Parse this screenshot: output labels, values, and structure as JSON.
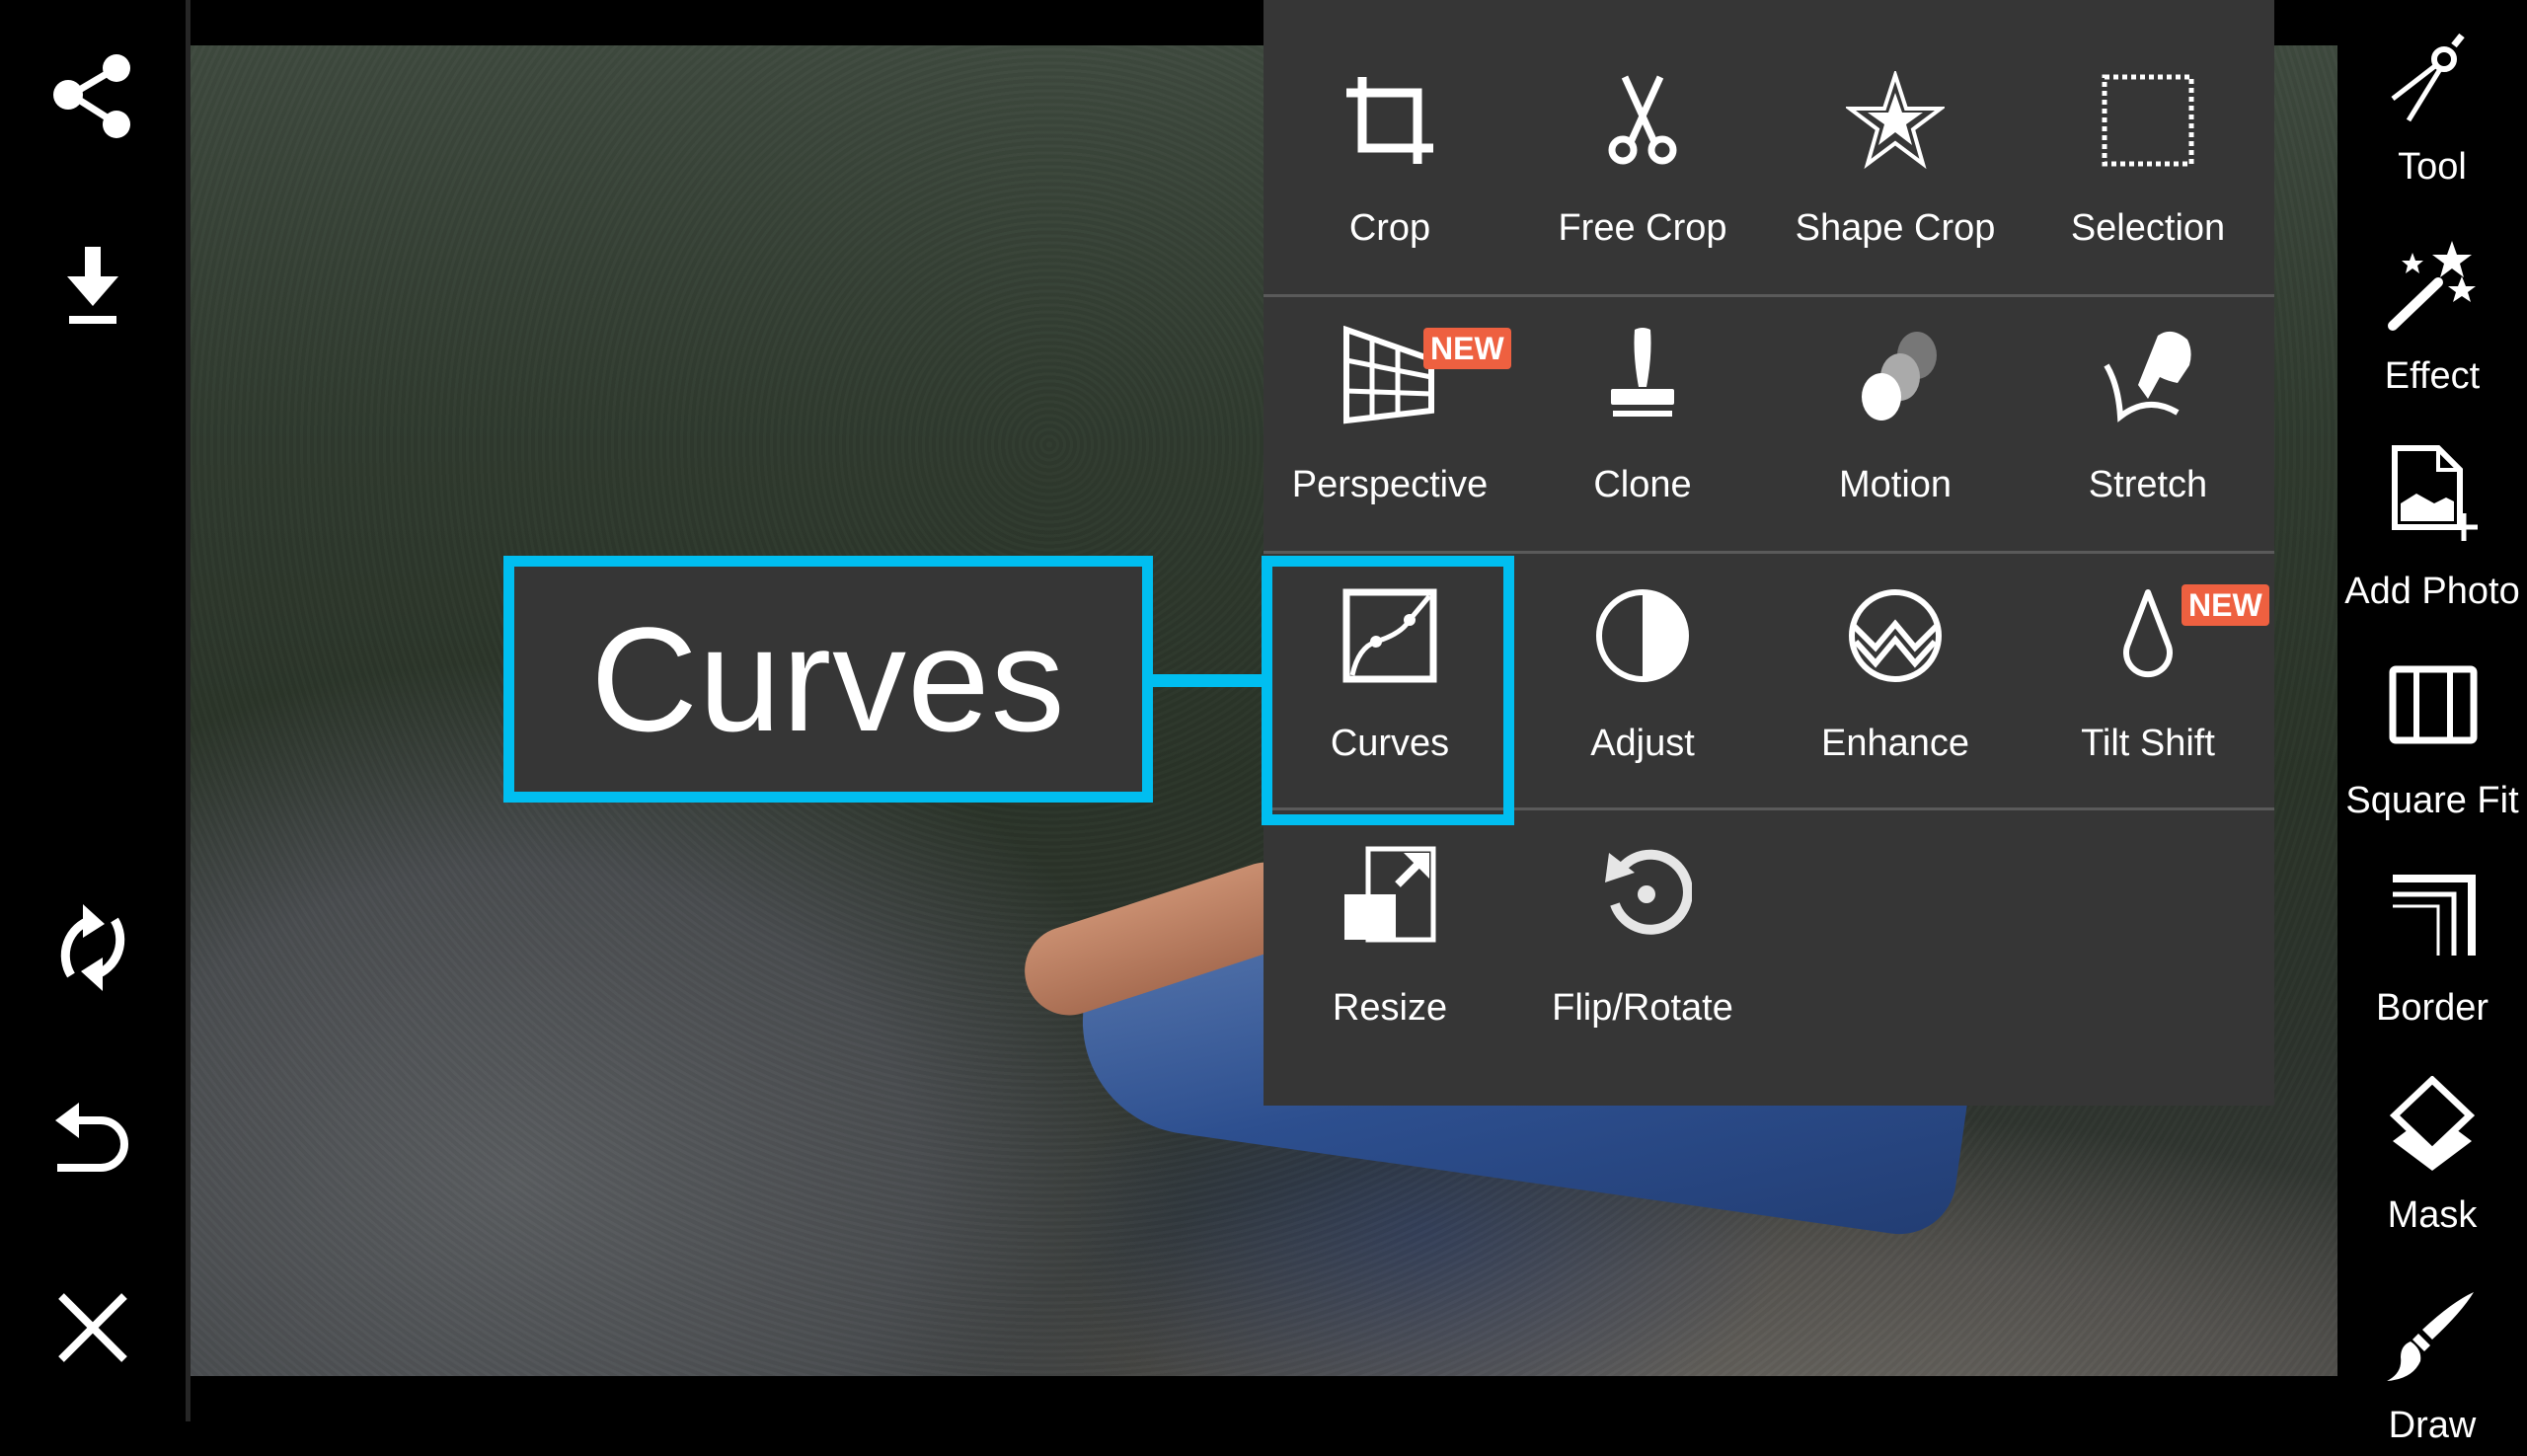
{
  "left_toolbar": {
    "buttons": [
      {
        "name": "share",
        "icon": "share-icon"
      },
      {
        "name": "download",
        "icon": "download-icon"
      },
      {
        "name": "refresh",
        "icon": "refresh-icon"
      },
      {
        "name": "undo",
        "icon": "undo-icon"
      },
      {
        "name": "close",
        "icon": "close-icon"
      }
    ]
  },
  "callout": {
    "label": "Curves"
  },
  "tool_menu": {
    "rows": [
      [
        {
          "label": "Crop",
          "icon": "crop-icon"
        },
        {
          "label": "Free Crop",
          "icon": "scissors-icon"
        },
        {
          "label": "Shape Crop",
          "icon": "star-icon"
        },
        {
          "label": "Selection",
          "icon": "dotted-selection-icon"
        }
      ],
      [
        {
          "label": "Perspective",
          "icon": "perspective-grid-icon",
          "badge": "NEW"
        },
        {
          "label": "Clone",
          "icon": "stamp-icon"
        },
        {
          "label": "Motion",
          "icon": "motion-circles-icon"
        },
        {
          "label": "Stretch",
          "icon": "stretch-hand-icon"
        }
      ],
      [
        {
          "label": "Curves",
          "icon": "curves-icon",
          "selected": true
        },
        {
          "label": "Adjust",
          "icon": "contrast-icon"
        },
        {
          "label": "Enhance",
          "icon": "enhance-icon"
        },
        {
          "label": "Tilt Shift",
          "icon": "drop-icon",
          "badge": "NEW"
        }
      ],
      [
        {
          "label": "Resize",
          "icon": "resize-icon"
        },
        {
          "label": "Flip/Rotate",
          "icon": "rotate-icon"
        }
      ]
    ]
  },
  "right_toolbar": {
    "items": [
      {
        "label": "Tool",
        "icon": "compass-icon"
      },
      {
        "label": "Effect",
        "icon": "magic-wand-icon"
      },
      {
        "label": "Add Photo",
        "icon": "add-photo-icon"
      },
      {
        "label": "Square Fit",
        "icon": "square-fit-icon"
      },
      {
        "label": "Border",
        "icon": "border-icon"
      },
      {
        "label": "Mask",
        "icon": "mask-layers-icon"
      },
      {
        "label": "Draw",
        "icon": "brush-icon"
      }
    ]
  },
  "colors": {
    "highlight": "#00BEF0",
    "badge": "#EE6040",
    "menu_bg": "#363636"
  }
}
